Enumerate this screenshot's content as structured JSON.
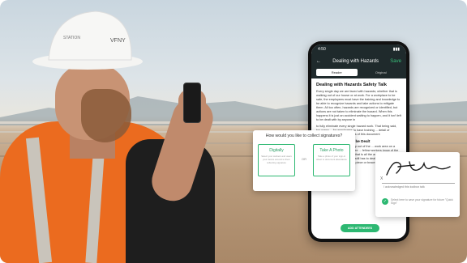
{
  "helmet": {
    "brand": "VFNY",
    "side_text": "STATION"
  },
  "phone": {
    "status_time": "4:50",
    "title": "Dealing with Hazards",
    "save_label": "Save",
    "tabs": [
      {
        "label": "Reader",
        "active": true
      },
      {
        "label": "Original",
        "active": false
      }
    ],
    "doc_title": "Dealing with Hazards Safety Talk",
    "paragraph_1": "Every single day we are faced with hazards; whether that is walking out of our house or at work. For a workplace to be safe, the employees must have the training and knowledge to be able to recognize hazards and take actions to mitigate them. All too often, hazards are recognized or identified, but actions are not taken to eliminate the hazard. When this happens it is just an accident waiting to happen, and it isn't left to be dealt with by anyone in",
    "paragraph_2": "to fully eliminate every single hazard work. That being said, too many ... for employees to have training ... detail of addressing them ... examples of this document",
    "subheading": "Hazards Being Left to be Dealt",
    "paragraph_3": "A piece of metal is sticking up out of the ... work area on a construction site. An employee ... fellow workers know of the presence of the ... however, that is all the action that is taken ... walking through that area still has to deal ... more effective response would be to flag ... piece or brace equipment over to remove the metal",
    "button_label": "ADD ATTENDEES",
    "accent": "#2db872"
  },
  "collect_card": {
    "question": "How would you like to collect signatures?",
    "option_1": {
      "title": "Digitally",
      "desc": "Select your workers and users your device around to them collecting signature"
    },
    "or_label": "OR",
    "option_2": {
      "title": "Take A Photo",
      "desc": "Take a photo of your sign-in sheet to document attendance"
    }
  },
  "signature_card": {
    "x_mark": "X",
    "caption": "I acknowledged this toolbox talk",
    "check_icon": "✓",
    "quick_sign_text": "Select here to save your signature for future \"Quick Sign\""
  }
}
